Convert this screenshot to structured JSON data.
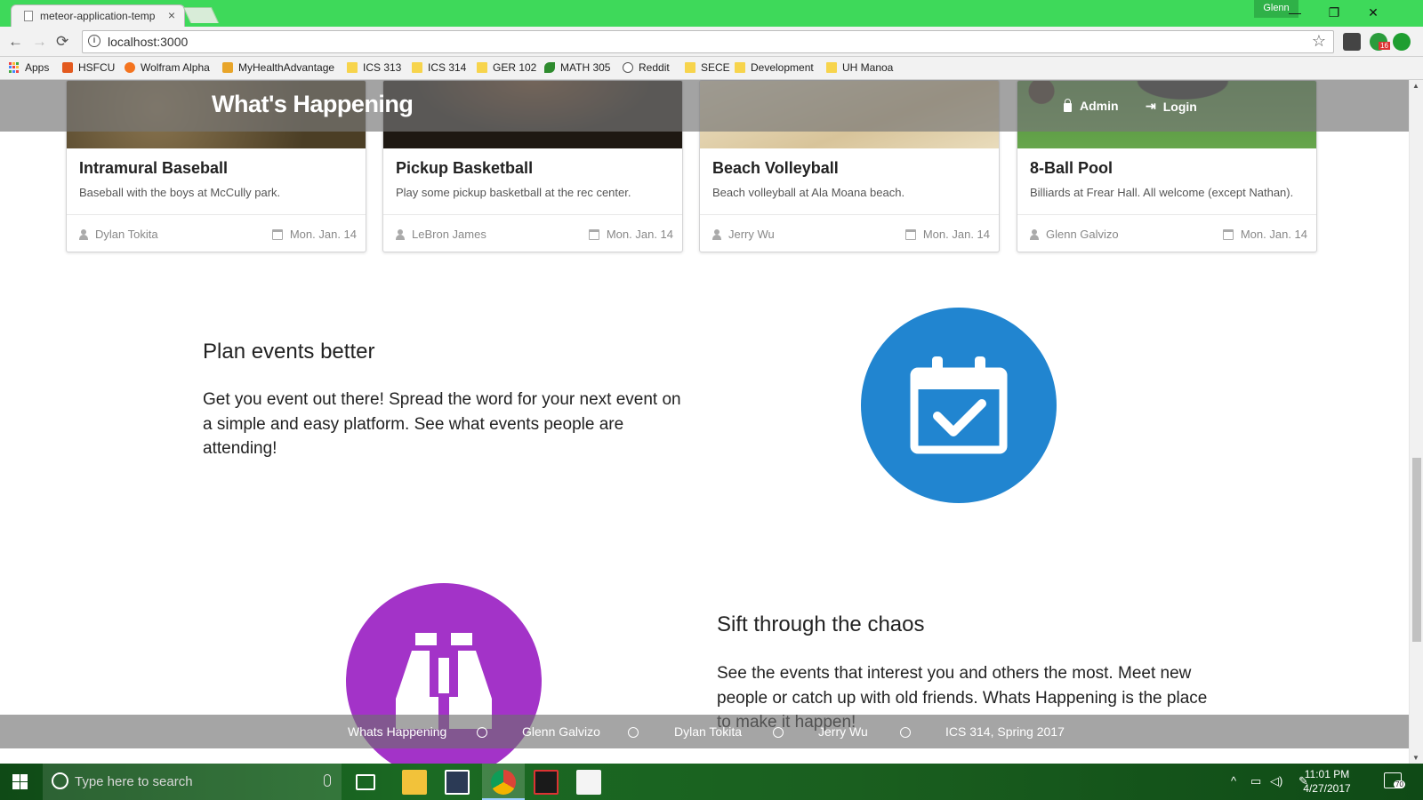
{
  "browser": {
    "tab_title": "meteor-application-temp",
    "tab_close": "×",
    "profile_name": "Glenn",
    "window_controls": {
      "minimize": "—",
      "restore": "❐",
      "close": "✕"
    },
    "nav": {
      "back": "←",
      "forward": "→",
      "reload": "⟳"
    },
    "url": "localhost:3000",
    "info_icon_glyph": "i",
    "bookmark_star": "☆",
    "extension_badge": "16",
    "bookmarks": [
      {
        "label": "Apps",
        "icon": "apps-grid-icon"
      },
      {
        "label": "HSFCU",
        "icon": "hsfcu-icon"
      },
      {
        "label": "Wolfram Alpha",
        "icon": "wolfram-icon"
      },
      {
        "label": "MyHealthAdvantage",
        "icon": "health-icon"
      },
      {
        "label": "ICS 313",
        "icon": "folder-icon"
      },
      {
        "label": "ICS 314",
        "icon": "folder-icon"
      },
      {
        "label": "GER 102",
        "icon": "folder-icon"
      },
      {
        "label": "MATH 305",
        "icon": "math-icon"
      },
      {
        "label": "Reddit",
        "icon": "reddit-icon"
      },
      {
        "label": "SECE",
        "icon": "folder-icon"
      },
      {
        "label": "Development",
        "icon": "folder-icon"
      },
      {
        "label": "UH Manoa",
        "icon": "folder-icon"
      }
    ]
  },
  "header": {
    "brand": "What's Happening",
    "menu": [
      {
        "label": "Admin",
        "icon": "lock-icon"
      },
      {
        "label": "Login",
        "icon": "sign-in-icon"
      }
    ]
  },
  "cards": [
    {
      "title": "Intramural Baseball",
      "description": "Baseball with the boys at McCully park.",
      "author": "Dylan Tokita",
      "date": "Mon. Jan. 14",
      "image_color": "#6b5b3a"
    },
    {
      "title": "Pickup Basketball",
      "description": "Play some pickup basketball at the rec center.",
      "author": "LeBron James",
      "date": "Mon. Jan. 14",
      "image_color": "#1e1812"
    },
    {
      "title": "Beach Volleyball",
      "description": "Beach volleyball at Ala Moana beach.",
      "author": "Jerry Wu",
      "date": "Mon. Jan. 14",
      "image_color": "#e2d2ae"
    },
    {
      "title": "8-Ball Pool",
      "description": "Billiards at Frear Hall. All welcome (except Nathan).",
      "author": "Glenn Galvizo",
      "date": "Mon. Jan. 14",
      "image_color": "#5e9a45"
    }
  ],
  "sections": [
    {
      "title": "Plan events better",
      "text": "Get you event out there! Spread the word for your next event on a simple and easy platform. See what events people are attending!",
      "icon": "calendar-check-icon",
      "color": "#2185d0"
    },
    {
      "title": "Sift through the chaos",
      "text": "See the events that interest you and others the most. Meet new people or catch up with old friends. Whats Happening is the place to make it happen!",
      "icon": "binoculars-icon",
      "color": "#a333c8"
    }
  ],
  "footer": {
    "items": [
      "Whats Happening",
      "Glenn Galvizo",
      "Dylan Tokita",
      "Jerry Wu",
      "ICS 314, Spring 2017"
    ]
  },
  "taskbar": {
    "search_placeholder": "Type here to search",
    "time": "11:01 PM",
    "date": "4/27/2017",
    "notification_count": "70"
  },
  "colors": {
    "browser_frame": "#3ed95a",
    "primary_blue": "#2185d0",
    "purple": "#a333c8"
  }
}
